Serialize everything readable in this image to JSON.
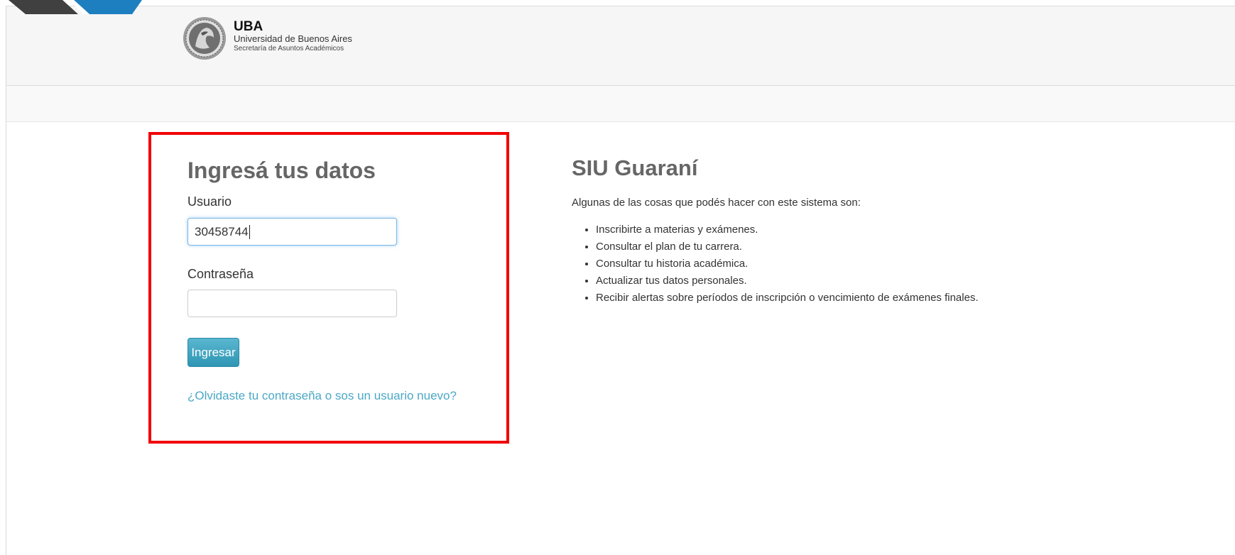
{
  "header": {
    "brand_name": "UBA",
    "university": "Universidad de Buenos Aires",
    "department": "Secretaría de Asuntos Académicos"
  },
  "login": {
    "title": "Ingresá tus datos",
    "user_label": "Usuario",
    "user_value": "30458744",
    "password_label": "Contraseña",
    "password_value": "",
    "submit_label": "Ingresar",
    "forgot_link": "¿Olvidaste tu contraseña o sos un usuario nuevo?"
  },
  "info": {
    "title": "SIU Guaraní",
    "intro": "Algunas de las cosas que podés hacer con este sistema son:",
    "items": [
      "Inscribirte a materias y exámenes.",
      "Consultar el plan de tu carrera.",
      "Consultar tu historia académica.",
      "Actualizar tus datos personales.",
      "Recibir alertas sobre períodos de inscripción o vencimiento de exámenes finales."
    ]
  },
  "colors": {
    "highlight_border": "#f10000",
    "button": "#2f96b4",
    "link": "#4ba8c6",
    "header_bg": "#f6f6f6"
  },
  "icons": {
    "logo": "uba-seal-icon"
  }
}
